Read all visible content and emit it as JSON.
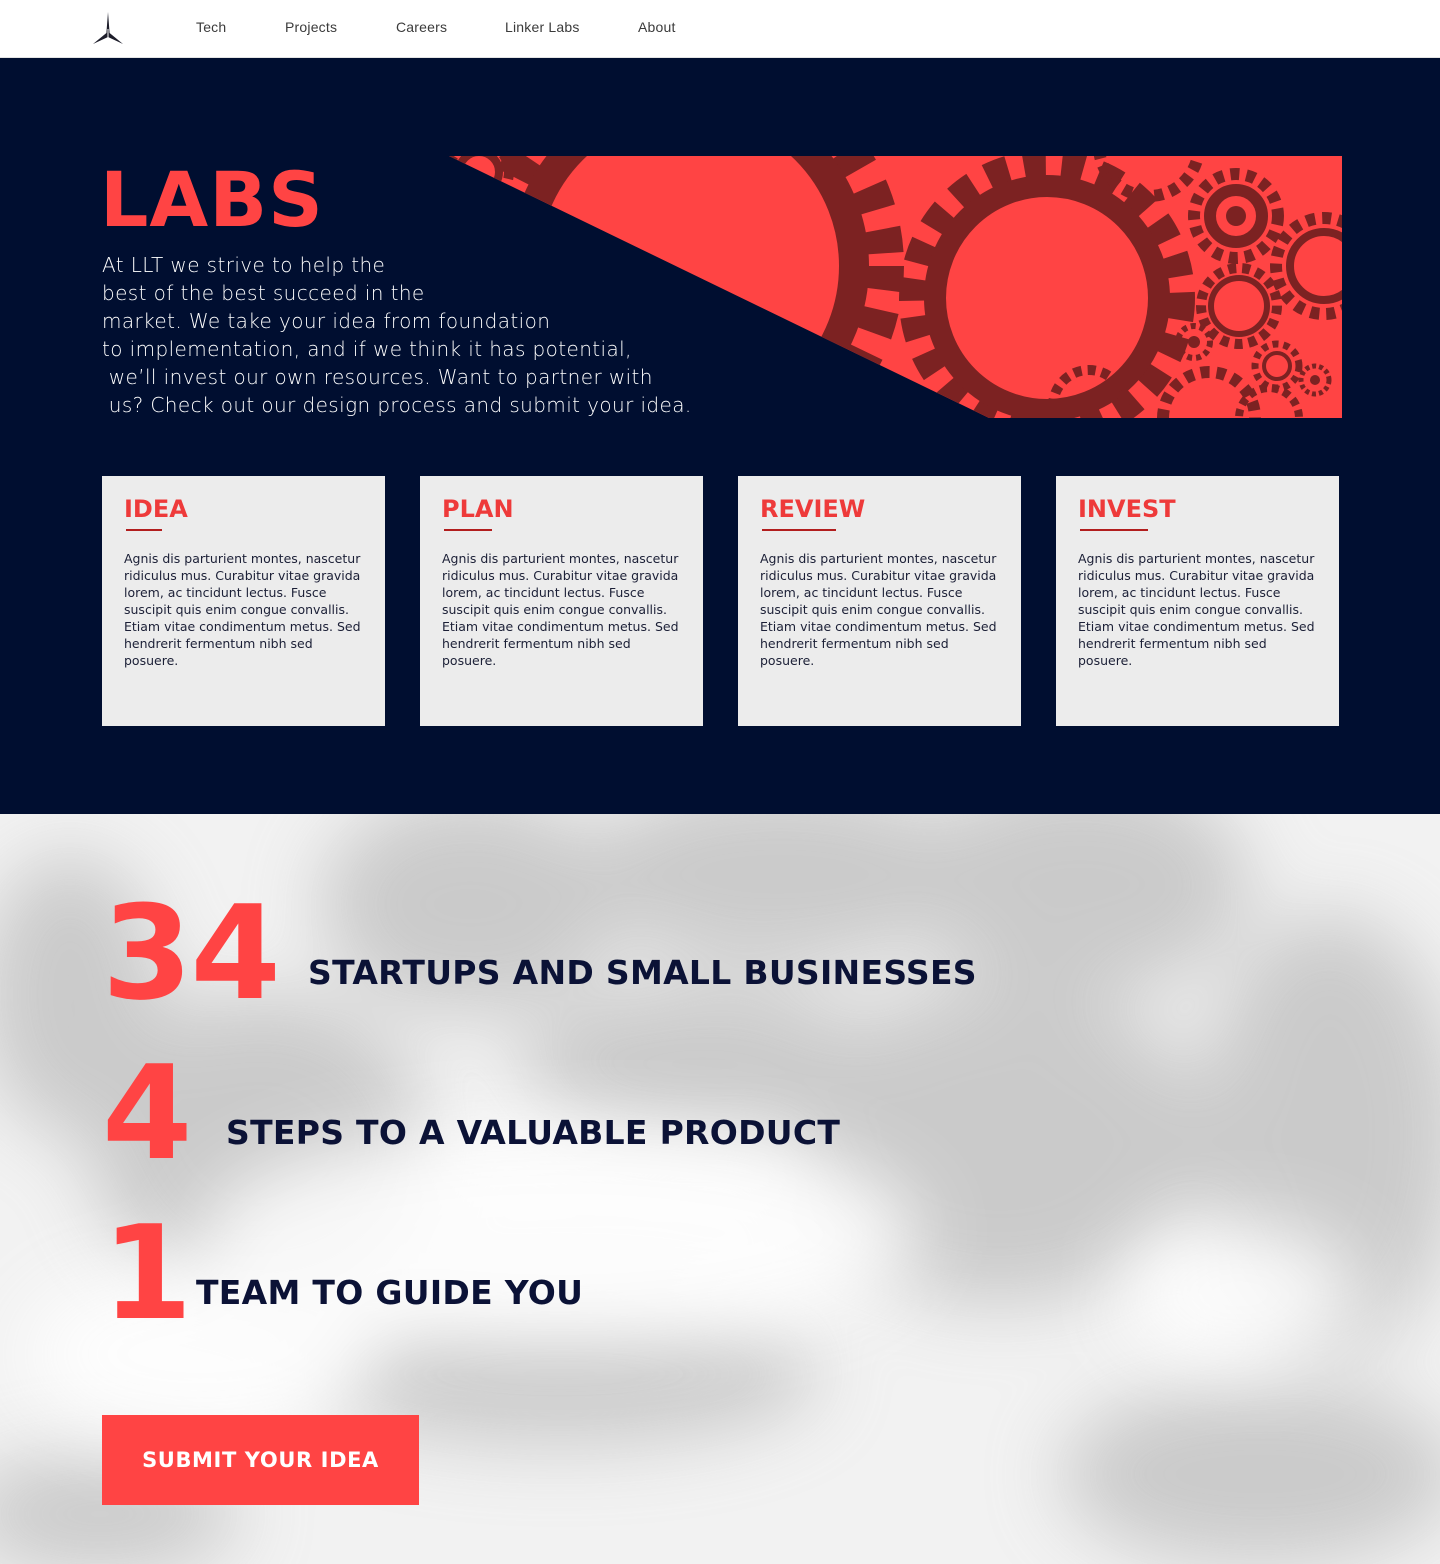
{
  "nav": {
    "logo_icon": "compass-star-icon",
    "items": [
      {
        "label": "Tech"
      },
      {
        "label": "Projects"
      },
      {
        "label": "Careers"
      },
      {
        "label": "Linker Labs"
      },
      {
        "label": "About"
      }
    ]
  },
  "hero": {
    "title": "LABS",
    "description_lines": [
      "At LLT we strive to help the",
      "best of the best succeed in the",
      "market. We take your idea from foundation",
      "to implementation, and if we think it has potential,",
      " we’ll invest our own resources. Want to partner with",
      " us? Check out our design process and submit your idea."
    ],
    "banner_image": "gears-illustration"
  },
  "cards": [
    {
      "title": "IDEA",
      "body": "Agnis dis parturient montes, nascetur ridiculus mus. Curabitur vitae gravida lorem, ac tincidunt lectus. Fusce suscipit quis enim congue convallis. Etiam vitae condimentum metus. Sed hendrerit fermentum nibh sed posuere."
    },
    {
      "title": "PLAN",
      "body": "Agnis dis parturient montes, nascetur ridiculus mus. Curabitur vitae gravida lorem, ac tincidunt lectus. Fusce suscipit quis enim congue convallis. Etiam vitae condimentum metus. Sed hendrerit fermentum nibh sed posuere."
    },
    {
      "title": "REVIEW",
      "body": "Agnis dis parturient montes, nascetur ridiculus mus. Curabitur vitae gravida lorem, ac tincidunt lectus. Fusce suscipit quis enim congue convallis. Etiam vitae condimentum metus. Sed hendrerit fermentum nibh sed posuere."
    },
    {
      "title": "INVEST",
      "body": "Agnis dis parturient montes, nascetur ridiculus mus. Curabitur vitae gravida lorem, ac tincidunt lectus. Fusce suscipit quis enim congue convallis. Etiam vitae condimentum metus. Sed hendrerit fermentum nibh sed posuere."
    }
  ],
  "stats": [
    {
      "number": "34",
      "label": "STARTUPS AND SMALL BUSINESSES"
    },
    {
      "number": "4",
      "label": "STEPS TO A VALUABLE PRODUCT"
    },
    {
      "number": "1",
      "label": "TEAM TO GUIDE YOU"
    }
  ],
  "cta": {
    "label": "SUBMIT YOUR IDEA"
  },
  "colors": {
    "accent": "#ff4444",
    "navy": "#000e30",
    "card_bg": "#ececec",
    "gear_dark": "#7c2222"
  }
}
